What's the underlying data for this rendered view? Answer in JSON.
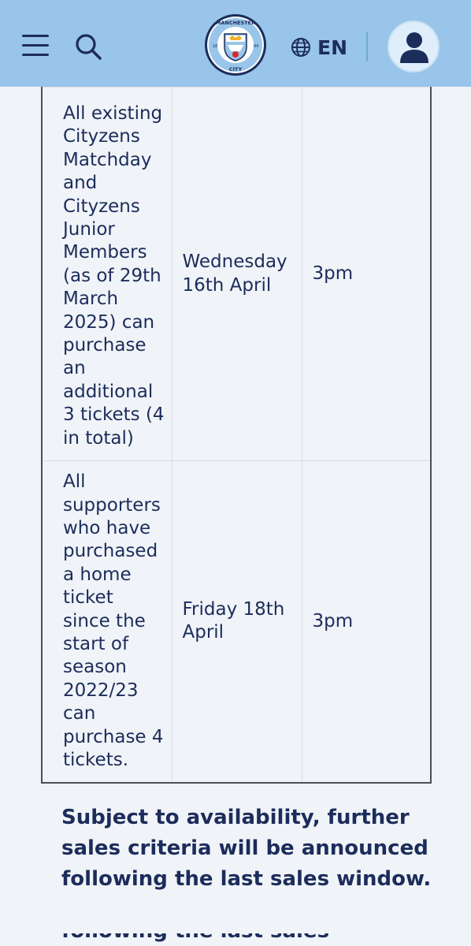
{
  "header": {
    "menu_icon": "hamburger-menu-icon",
    "search_icon": "search-icon",
    "logo_icon": "manchester-city-crest",
    "language_icon": "globe-icon",
    "language": "EN",
    "account_icon": "user-account-icon"
  },
  "table": {
    "rows": [
      {
        "eligibility": "All existing Cityzens Matchday and Cityzens Junior Members (as of 29th March 2025) can purchase an additional 3 tickets (4 in total)",
        "date": "Wednesday 16th April",
        "time": "3pm"
      },
      {
        "eligibility": "All supporters who have purchased a home ticket since the start of season 2022/23 can purchase 4 tickets.",
        "date": "Friday 18th April",
        "time": "3pm"
      }
    ]
  },
  "note": "Subject to availability, further sales criteria will be announced following the last sales window.",
  "note_fragment": "following the last sales",
  "colors": {
    "header_bg": "#98c5e9",
    "page_bg": "#f0f4f8",
    "text": "#1c2c5b"
  }
}
